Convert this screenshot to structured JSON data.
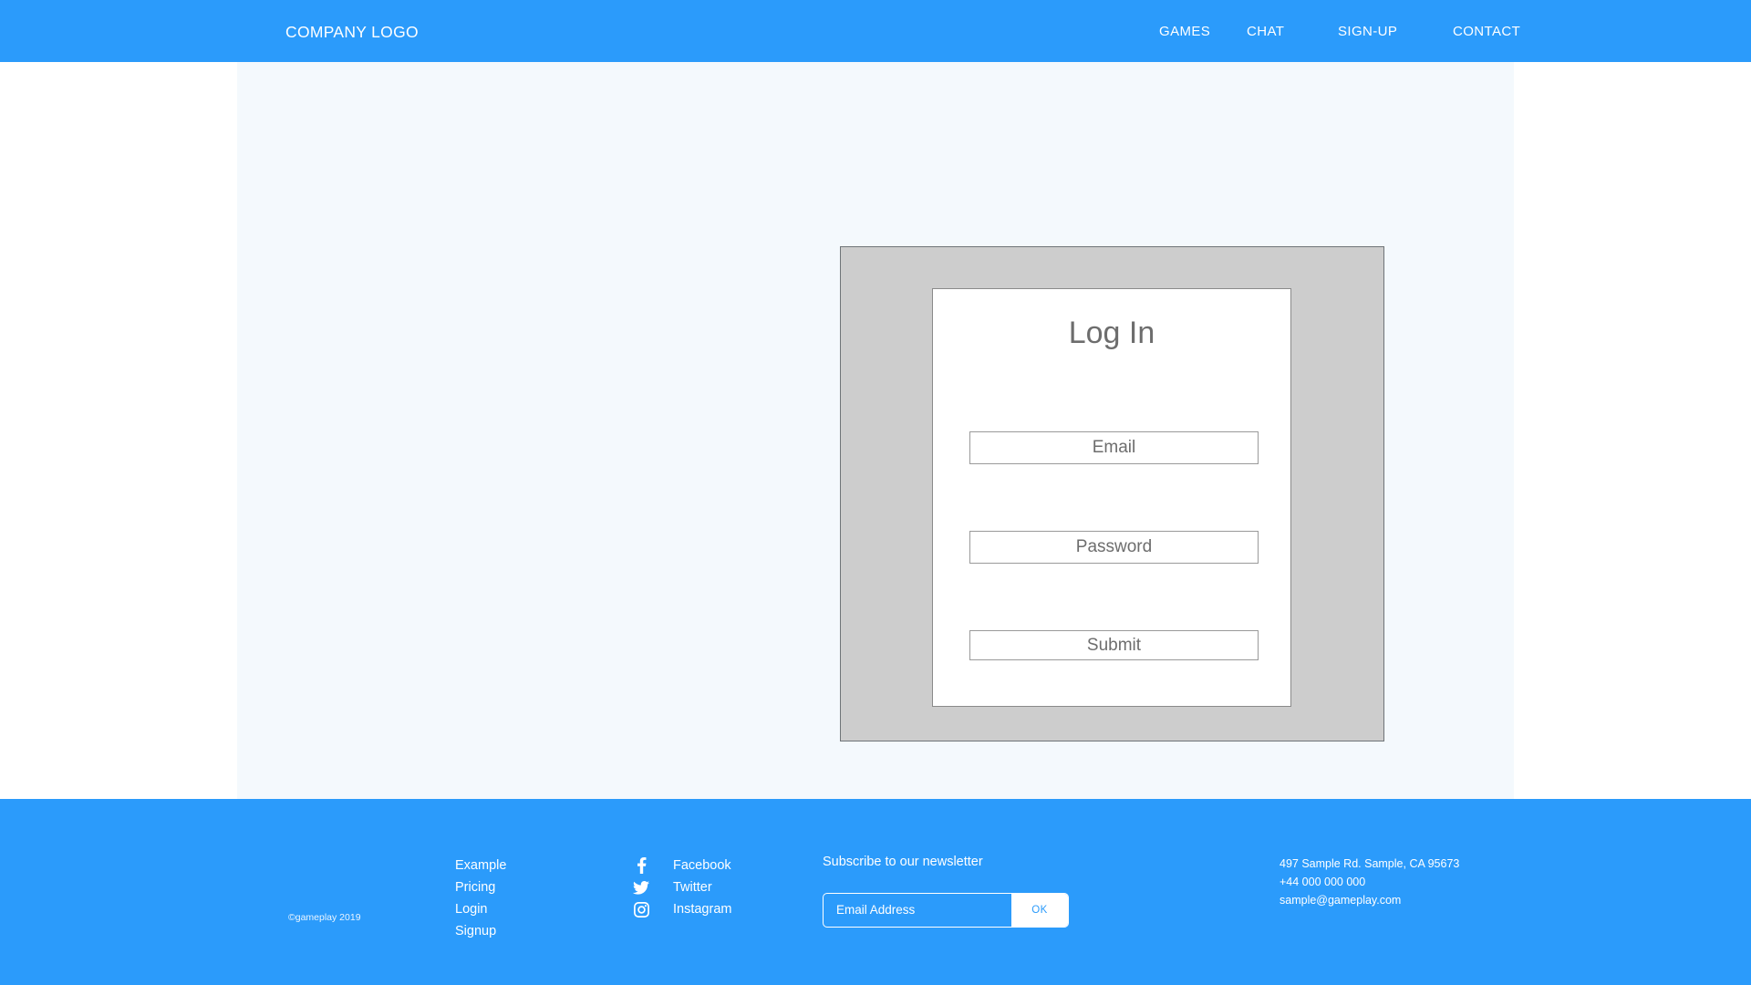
{
  "theme": {
    "brand_blue": "#2b9bfb",
    "content_bg": "#f4f9fd",
    "frame_gray": "#cdcdcd",
    "card_white": "#ffffff",
    "muted_text": "#6d6d6d"
  },
  "header": {
    "brand": "COMPANY LOGO",
    "nav": [
      {
        "label": "GAMES"
      },
      {
        "label": "CHAT"
      },
      {
        "label": "SIGN-UP"
      },
      {
        "label": "CONTACT"
      }
    ]
  },
  "login": {
    "title": "Log In",
    "email_value": "Email",
    "password_value": "Password",
    "submit_label": "Submit"
  },
  "footer": {
    "copyright": "©gameplay 2019",
    "links": [
      {
        "label": "Example"
      },
      {
        "label": "Pricing"
      },
      {
        "label": "Login"
      },
      {
        "label": "Signup"
      }
    ],
    "social": [
      {
        "icon": "facebook-icon",
        "label": "Facebook"
      },
      {
        "icon": "twitter-icon",
        "label": "Twitter"
      },
      {
        "icon": "instagram-icon",
        "label": "Instagram"
      }
    ],
    "newsletter": {
      "title": "Subscribe to our newsletter",
      "placeholder": "Email Address",
      "value": "",
      "button_label": "OK"
    },
    "address": [
      {
        "text": "497 Sample Rd. Sample, CA 95673"
      },
      {
        "text": "+44 000 000 000"
      },
      {
        "text": "sample@gameplay.com"
      }
    ]
  }
}
